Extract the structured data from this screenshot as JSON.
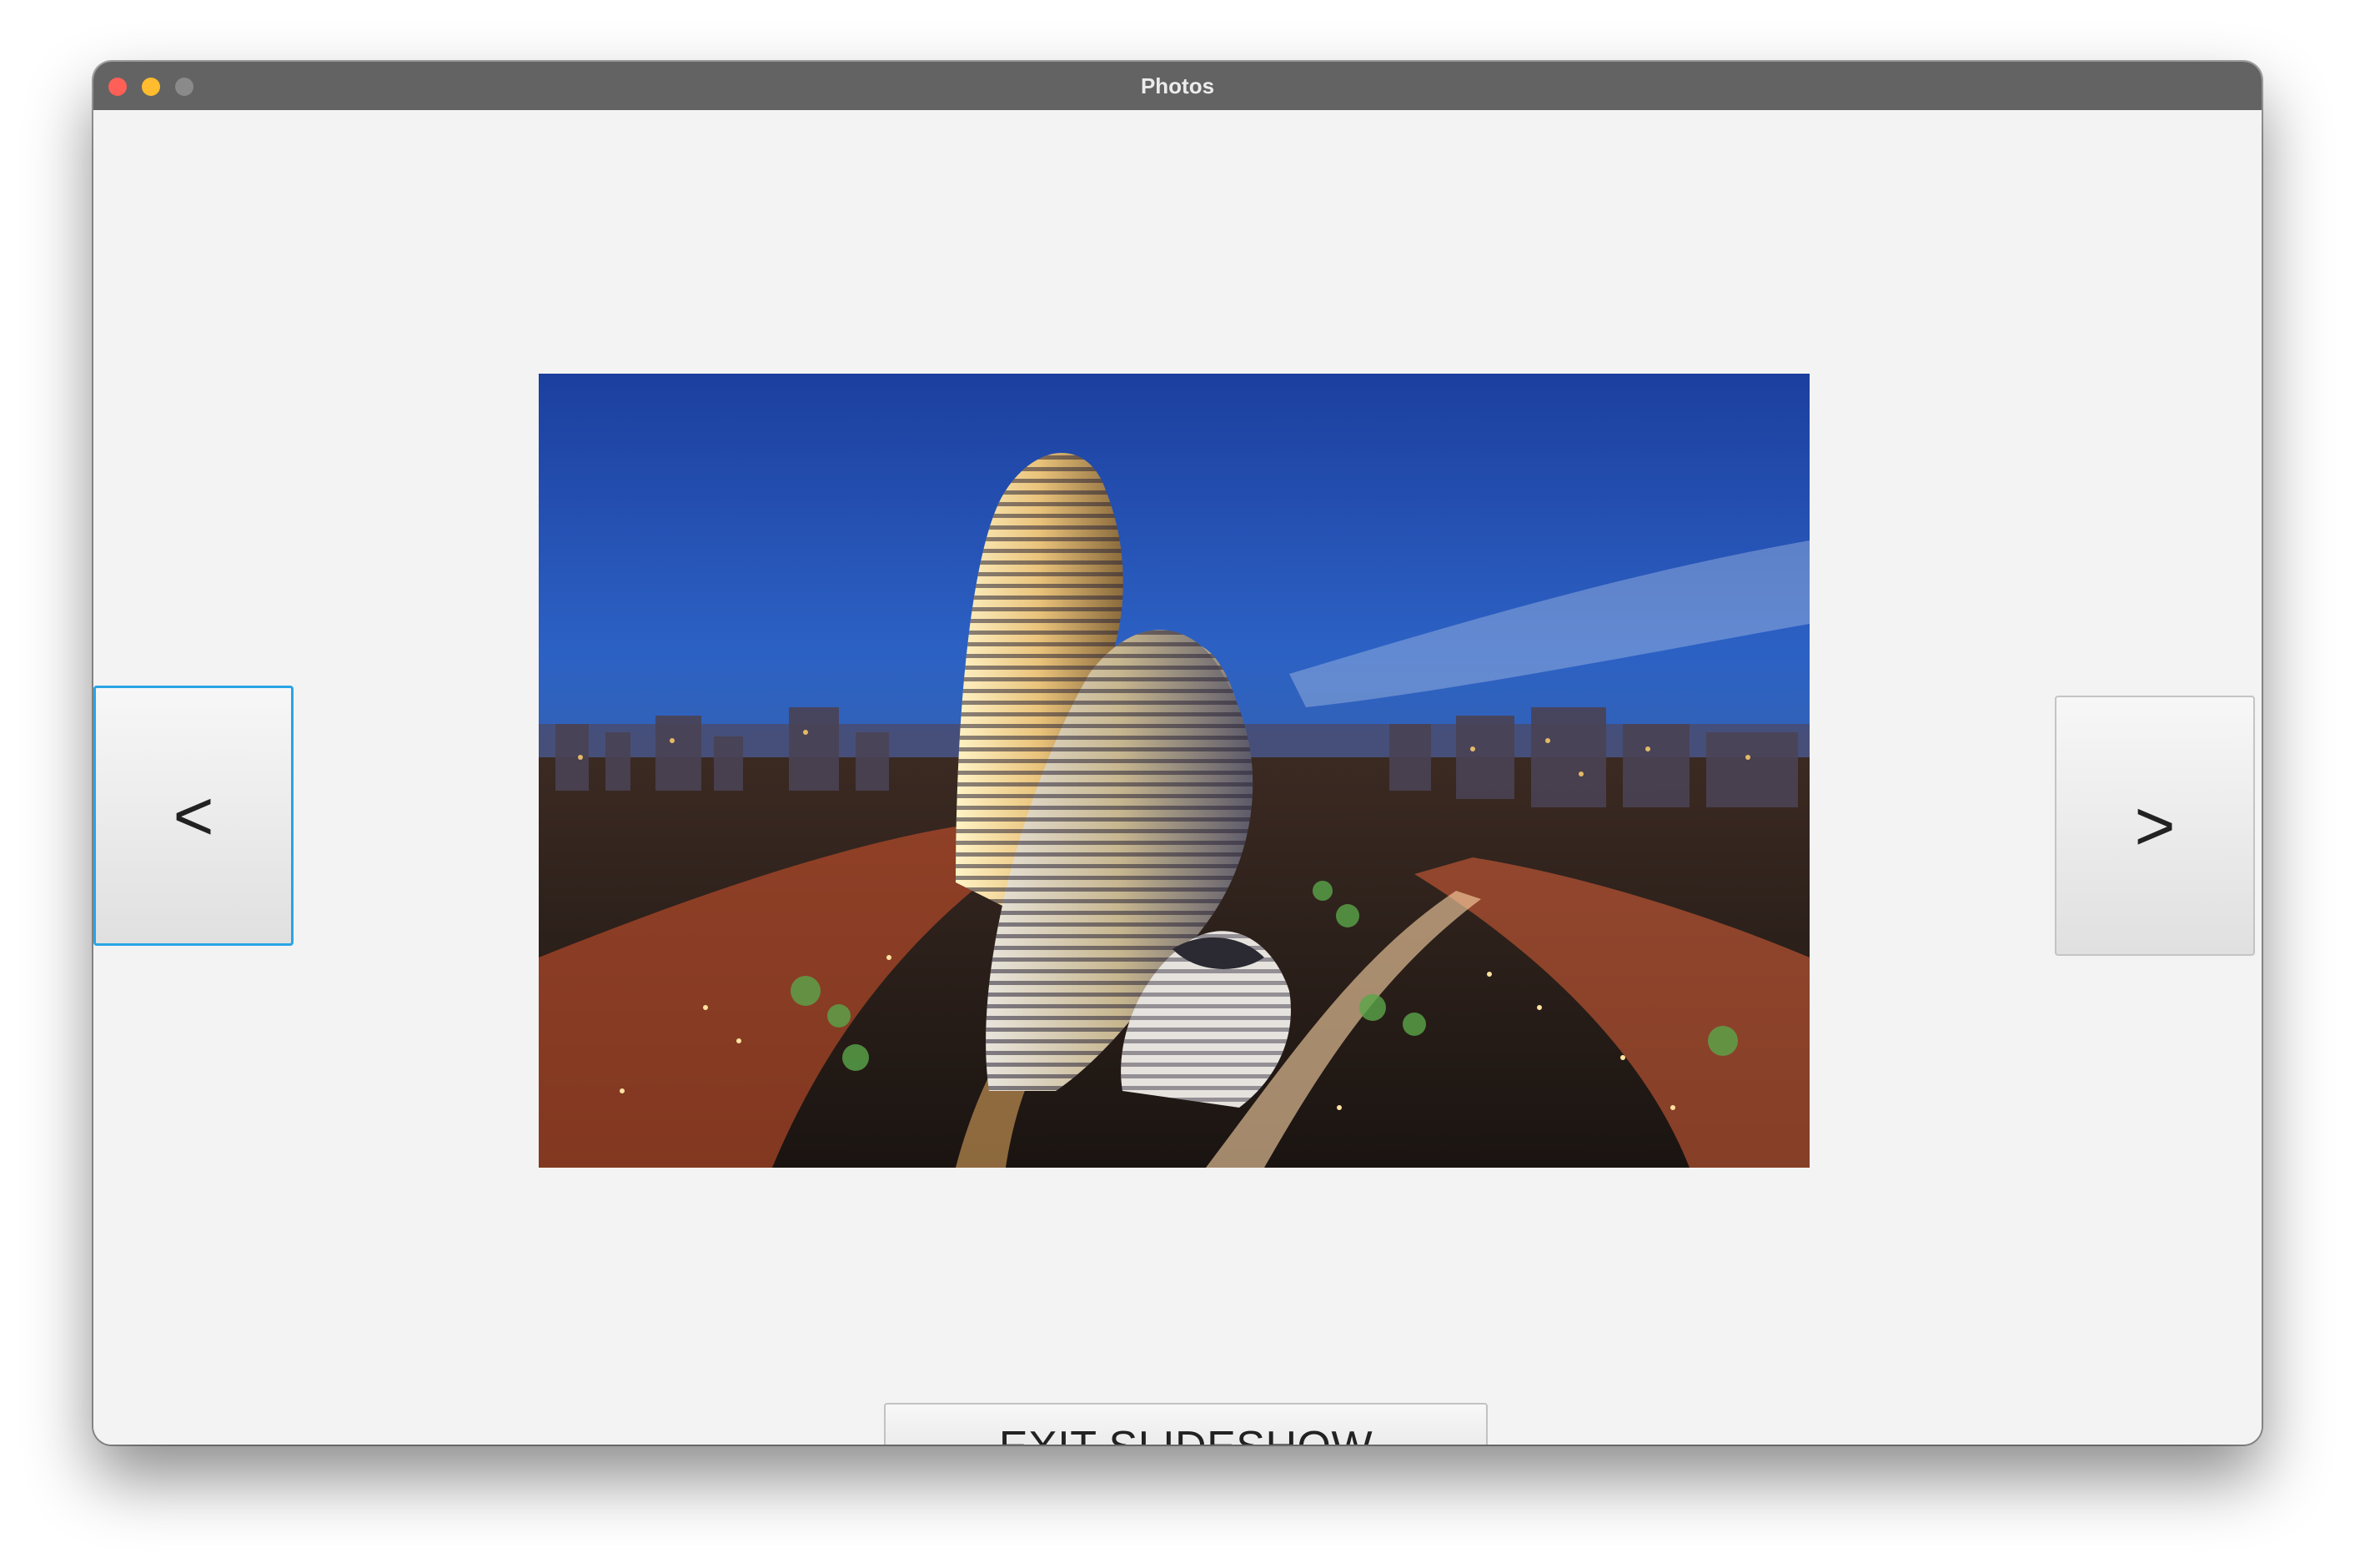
{
  "window": {
    "title": "Photos"
  },
  "slideshow": {
    "prev_label": "<",
    "next_label": ">",
    "exit_label": "EXIT SLIDESHOW"
  },
  "photo": {
    "subject": "city-skyline-night-photo"
  }
}
